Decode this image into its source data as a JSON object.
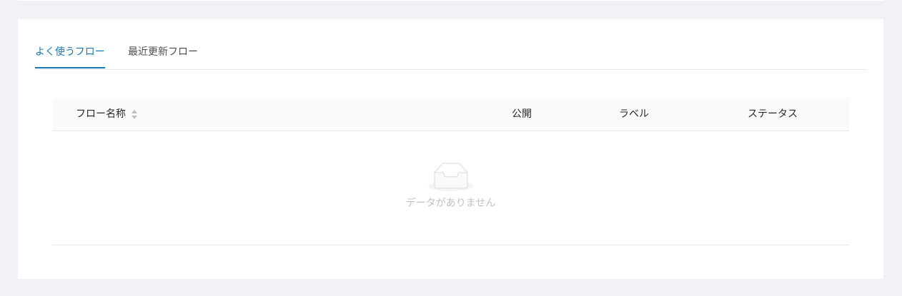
{
  "tabs": [
    {
      "label": "よく使うフロー",
      "active": true
    },
    {
      "label": "最近更新フロー",
      "active": false
    }
  ],
  "table": {
    "columns": [
      {
        "label": "フロー名称",
        "sortable": true
      },
      {
        "label": "公開"
      },
      {
        "label": "ラベル"
      },
      {
        "label": "ステータス"
      }
    ],
    "empty_text": "データがありません"
  },
  "colors": {
    "accent": "#1677b8",
    "page_background": "#f0f2f5",
    "header_background": "#fafafa"
  }
}
